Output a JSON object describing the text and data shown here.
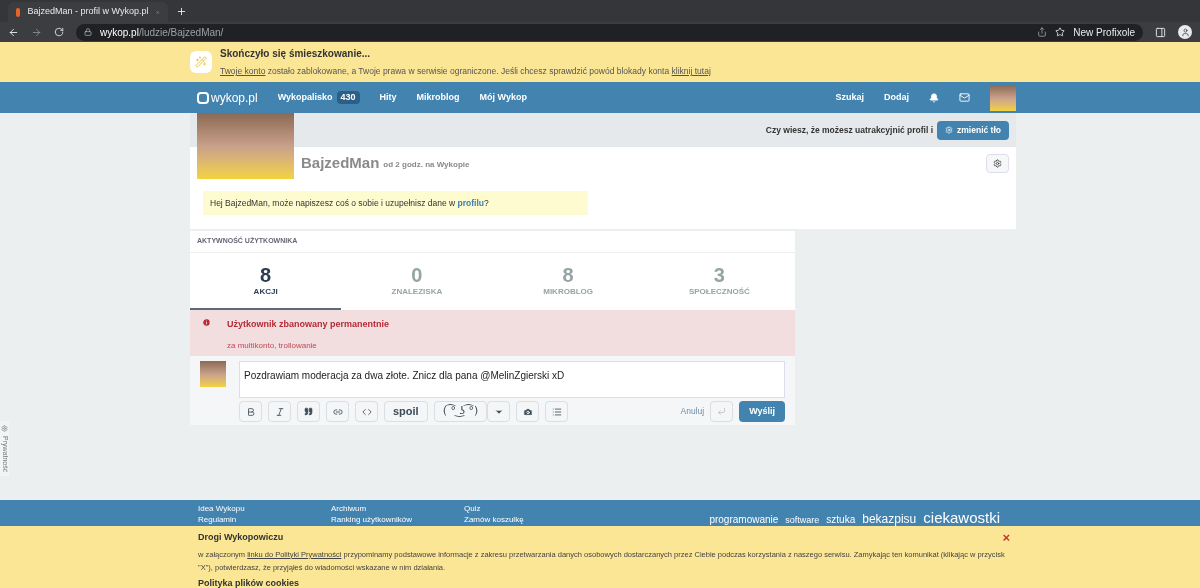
{
  "browser": {
    "tab_title": "BajzedMan - profil w Wykop.pl",
    "url_host": "wykop.pl",
    "url_path": "/ludzie/BajzedMan/",
    "profile": "New Profixole"
  },
  "ban_banner": {
    "title": "Skończyło się śmieszkowanie...",
    "link1": "Twoje konto",
    "text": "zostało zablokowane, a Twoje prawa w serwisie ograniczone. Jeśli chcesz sprawdzić powód blokady konta",
    "link2": "kliknij tutaj"
  },
  "nav": {
    "logo": "wykop.pl",
    "items": [
      {
        "label": "Wykopalisko",
        "badge": "430"
      },
      {
        "label": "Hity"
      },
      {
        "label": "Mikroblog"
      },
      {
        "label": "Mój Wykop"
      }
    ],
    "right": [
      "Szukaj",
      "Dodaj"
    ]
  },
  "profile": {
    "hint": "Czy wiesz, że możesz uatrakcyjnić profil i",
    "bg_button": "zmienić tło",
    "username": "BajzedMan",
    "since": "od 2 godz. na Wykopie",
    "notice": "Hej BajzedMan, może napiszesz coś o sobie i uzupełnisz dane w **profilu**?"
  },
  "activity": {
    "heading": "AKTYWNOŚĆ UŻYTKOWNIKA",
    "tabs": [
      {
        "count": "8",
        "label": "AKCJI",
        "selected": true
      },
      {
        "count": "0",
        "label": "ZNALEZISKA",
        "selected": false
      },
      {
        "count": "8",
        "label": "MIKROBLOG",
        "selected": false
      },
      {
        "count": "3",
        "label": "SPOŁECZNOŚĆ",
        "selected": false
      }
    ],
    "ban": {
      "title": "Użytkownik zbanowany permanentnie",
      "reason": "za multikonto, trollowanie"
    }
  },
  "composer": {
    "value": "Pozdrawiam moderacja za dwa złote. Znicz dla pana @MelinZgierski xD",
    "spoil": "spoil",
    "lenny": "( ͡° ͜ʖ ͡°)",
    "cancel": "Anuluj",
    "send": "Wyślij"
  },
  "privacy_tab": "Prywatność",
  "footer": {
    "columns": [
      [
        "Idea Wykopu",
        "Regulamin"
      ],
      [
        "Archiwum",
        "Ranking użytkowników"
      ],
      [
        "Quiz",
        "Zamów koszulkę"
      ]
    ],
    "tags": [
      {
        "label": "programowanie",
        "kind": "medium"
      },
      {
        "label": "software",
        "kind": "small"
      },
      {
        "label": "sztuka",
        "kind": "medium"
      },
      {
        "label": "bekazpisu",
        "kind": "large"
      },
      {
        "label": "ciekawostki",
        "kind": "huge"
      }
    ]
  },
  "cookie": {
    "title": "Drogi Wykopowiczu",
    "text_before": "w załączonym",
    "link": "linku do Polityki Prywatności",
    "text_after": "przypominamy podstawowe informacje z zakresu przetwarzania danych osobowych dostarczanych przez Ciebie podczas korzystania z naszego serwisu. Zamykając ten komunikat (klikając w przycisk \"X\"), potwierdzasz, że przyjąłeś do wiadomości wskazane w nim działania.",
    "subtitle": "Polityka plików cookies",
    "close": "×"
  }
}
